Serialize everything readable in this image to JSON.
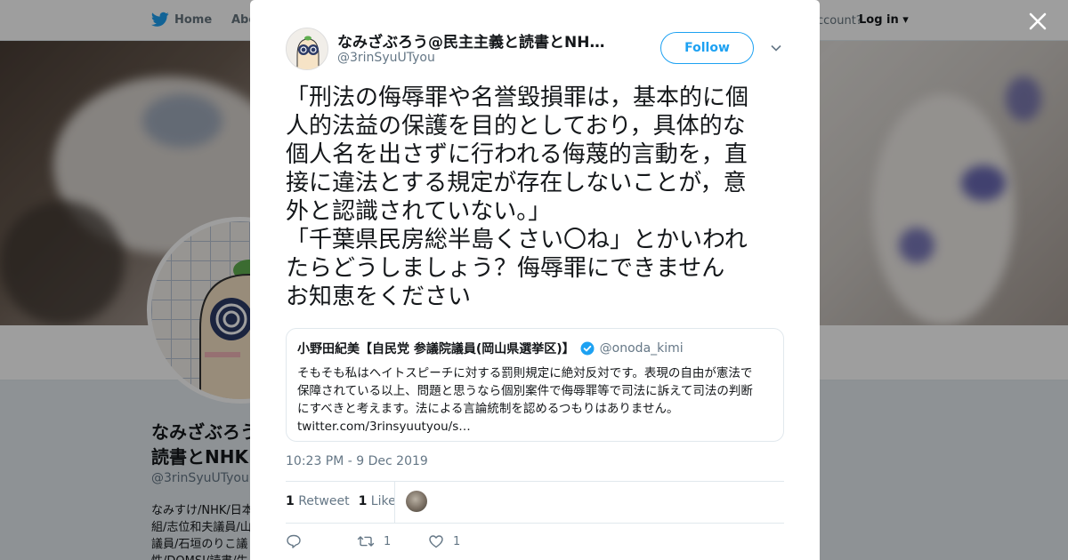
{
  "topbar": {
    "home_label": "Home",
    "about_label": "Abo",
    "account_text": "ccount?",
    "login_label": "Log in"
  },
  "profile": {
    "name_line1": "なみざぶろう",
    "name_line2": "読書とNHK",
    "handle": "@3rinSyuUTyou",
    "bio_lines": [
      "なみすけ/NHK/日本",
      "組/志位和夫議員/山",
      "議員/石垣のりこ議",
      "性/DOMSI/読書/生"
    ]
  },
  "tweet": {
    "author_name": "なみざぶろう@民主主義と読書とNH…",
    "author_handle": "@3rinSyuUTyou",
    "follow_label": "Follow",
    "text_lines": [
      "「刑法の侮辱罪や名誉毀損罪は，基本的に個",
      "人的法益の保護を目的としており，具体的な",
      "個人名を出さずに行われる侮蔑的言動を，直",
      "接に違法とする規定が存在しないことが，意",
      "外と認識されていない。」",
      "「千葉県民房総半島くさい〇ね」とかいわれ",
      "たらどうしましょう？侮辱罪にできません",
      "お知恵をください"
    ],
    "quote": {
      "name": "小野田紀美【自民党 参議院議員(岡山県選挙区)】",
      "handle": "@onoda_kimi",
      "text_lines": [
        "そもそも私はヘイトスピーチに対する罰則規定に絶対反対です。表現の自由が憲法で",
        "保障されている以上、問題と思うなら個別案件で侮辱罪等で司法に訴えて司法の判断",
        "にすべきと考えます。法による言論統制を認めるつもりはありません。",
        "twitter.com/3rinsyuutyou/s…"
      ]
    },
    "timestamp": "10:23 PM - 9 Dec 2019",
    "retweet_count": "1",
    "retweet_label": "Retweet",
    "like_count": "1",
    "like_label": "Like",
    "action_retweet_count": "1",
    "action_like_count": "1"
  },
  "colors": {
    "accent": "#1da1f2",
    "text": "#14171a",
    "muted": "#657786"
  }
}
